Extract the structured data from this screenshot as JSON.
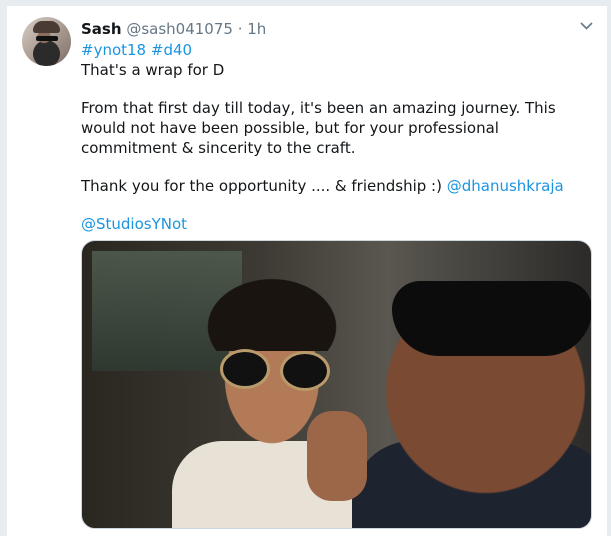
{
  "tweet": {
    "author_name": "Sash",
    "handle": "@sash041075",
    "separator": "·",
    "time": "1h",
    "menu_icon": "chevron-down-icon",
    "hashtags": [
      "#ynot18",
      "#d40"
    ],
    "line1": "That's a wrap for D",
    "paragraph2": "From that first day till today, it's been an amazing journey. This would not have been possible, but for your professional commitment & sincerity to the craft.",
    "paragraph3_text": "Thank you for the opportunity .... & friendship :) ",
    "mention1": "@dhanushkraja",
    "mention2": "@StudiosYNot",
    "colors": {
      "link": "#1b95e0",
      "text": "#14171a",
      "muted": "#657786"
    }
  }
}
